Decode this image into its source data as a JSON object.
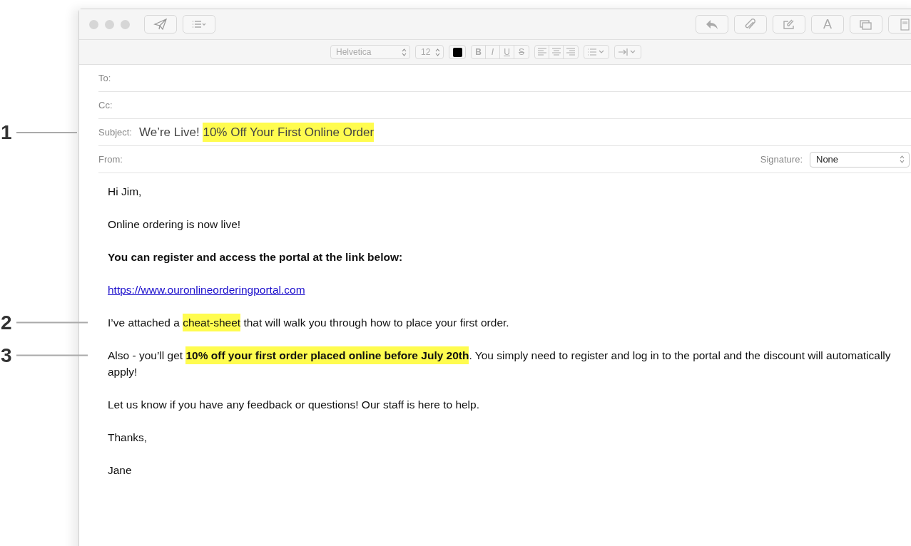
{
  "toolbar": {
    "left_buttons": [
      {
        "kind": "send"
      },
      {
        "kind": "list"
      }
    ],
    "right_buttons": [
      {
        "kind": "reply"
      },
      {
        "kind": "attach"
      },
      {
        "kind": "markup"
      },
      {
        "kind": "font",
        "label": "A"
      },
      {
        "kind": "window"
      },
      {
        "kind": "stationery"
      }
    ]
  },
  "format_bar": {
    "font": "Helvetica",
    "size": "12",
    "style_buttons": [
      {
        "kind": "bold",
        "label": "B"
      },
      {
        "kind": "italic",
        "label": "I"
      },
      {
        "kind": "underline",
        "label": "U"
      },
      {
        "kind": "strike",
        "label": "S"
      }
    ]
  },
  "header": {
    "to": {
      "label": "To:"
    },
    "cc": {
      "label": "Cc:"
    },
    "subject": {
      "label": "Subject:",
      "callout": "1",
      "segments": [
        {
          "text": "We’re Live!",
          "highlighted": false
        },
        {
          "text": "10% Off Your First Online Order",
          "highlighted": true
        }
      ]
    },
    "from": {
      "label": "From:"
    },
    "signature": {
      "label": "Signature:",
      "value": "None"
    }
  },
  "body": [
    {
      "kind": "plain",
      "segments": [
        {
          "text": "Hi Jim,",
          "highlighted": false,
          "bold": false
        }
      ]
    },
    {
      "kind": "plain",
      "segments": [
        {
          "text": "Online ordering is now live!",
          "highlighted": false,
          "bold": false
        }
      ]
    },
    {
      "kind": "plain",
      "segments": [
        {
          "text": "You can register and access the portal at the link below:",
          "highlighted": false,
          "bold": true
        }
      ]
    },
    {
      "kind": "link",
      "segments": [
        {
          "text": "https://www.ouronlineorderingportal.com",
          "highlighted": false,
          "bold": false
        }
      ]
    },
    {
      "kind": "plain",
      "callout": "2",
      "segments": [
        {
          "text": "I’ve attached a ",
          "highlighted": false,
          "bold": false
        },
        {
          "text": "cheat-sheet",
          "highlighted": true,
          "bold": false
        },
        {
          "text": " that will walk you through how to place your first order.",
          "highlighted": false,
          "bold": false
        }
      ]
    },
    {
      "kind": "plain",
      "callout": "3",
      "segments": [
        {
          "text": "Also - you’ll get ",
          "highlighted": false,
          "bold": false
        },
        {
          "text": "10% off your first order placed online before July 20th",
          "highlighted": true,
          "bold": true
        },
        {
          "text": ". You simply need to register and log in to the portal and the discount will automatically apply!",
          "highlighted": false,
          "bold": false
        }
      ]
    },
    {
      "kind": "plain",
      "segments": [
        {
          "text": "Let us know if you have any feedback or questions! Our staff is here to help.",
          "highlighted": false,
          "bold": false
        }
      ]
    },
    {
      "kind": "plain",
      "segments": [
        {
          "text": "Thanks,",
          "highlighted": false,
          "bold": false
        }
      ]
    },
    {
      "kind": "plain",
      "segments": [
        {
          "text": "Jane",
          "highlighted": false,
          "bold": false
        }
      ]
    }
  ]
}
